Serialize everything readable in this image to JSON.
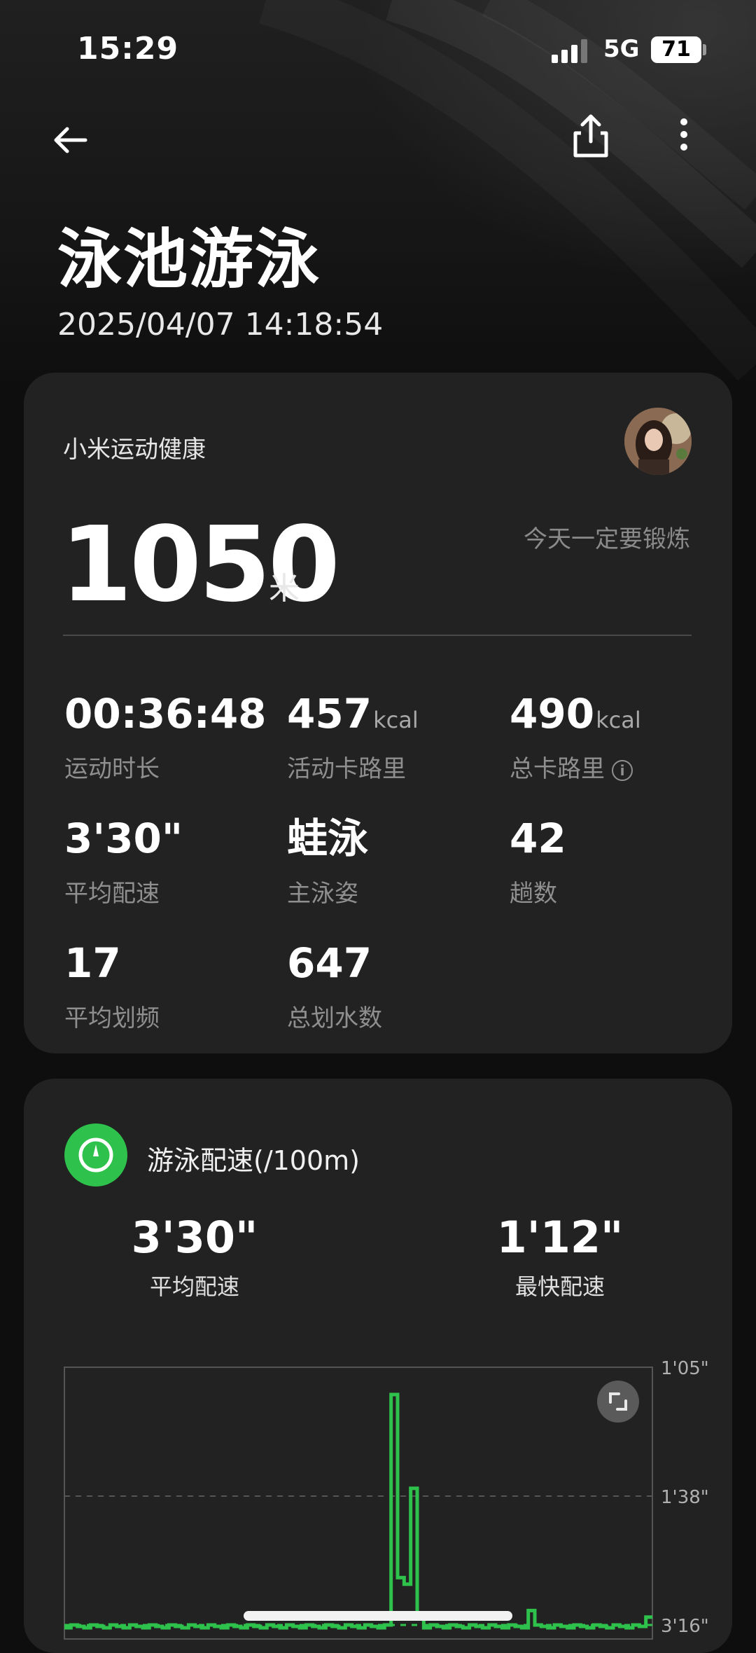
{
  "status_bar": {
    "time": "15:29",
    "network": "5G",
    "battery": "71"
  },
  "nav": {
    "back_icon": "arrow-left-icon",
    "share_icon": "share-icon",
    "more_icon": "more-vertical-icon"
  },
  "header": {
    "title": "泳池游泳",
    "datetime": "2025/04/07 14:18:54"
  },
  "summary": {
    "app_name": "小米运动健康",
    "distance": "1050",
    "distance_unit": "米",
    "motto": "今天一定要锻炼",
    "stats": [
      {
        "value": "00:36:48",
        "unit": "",
        "label": "运动时长"
      },
      {
        "value": "457",
        "unit": "kcal",
        "label": "活动卡路里"
      },
      {
        "value": "490",
        "unit": "kcal",
        "label": "总卡路里"
      },
      {
        "value": "3'30\"",
        "unit": "",
        "label": "平均配速"
      },
      {
        "value": "蛙泳",
        "unit": "",
        "label": "主泳姿"
      },
      {
        "value": "42",
        "unit": "",
        "label": "趟数"
      },
      {
        "value": "17",
        "unit": "",
        "label": "平均划频"
      },
      {
        "value": "647",
        "unit": "",
        "label": "总划水数"
      }
    ]
  },
  "pace": {
    "title": "游泳配速(/100m)",
    "avg_value": "3'30\"",
    "avg_label": "平均配速",
    "fast_value": "1'12\"",
    "fast_label": "最快配速"
  },
  "chart_data": {
    "type": "line",
    "title": "",
    "xlabel": "",
    "ylabel": "",
    "y_ticks": [
      "1'05\"",
      "1'38\"",
      "3'16\""
    ],
    "y_axis_side": "right",
    "y_inverted": true,
    "grid": true,
    "series": [
      {
        "color": "#2ec14c",
        "shape": "step",
        "y_seconds": [
          198,
          196,
          197,
          198,
          196,
          197,
          198,
          196,
          197,
          198,
          196,
          197,
          198,
          196,
          197,
          198,
          196,
          197,
          198,
          196,
          197,
          198,
          196,
          197,
          198,
          196,
          197,
          198,
          196,
          197,
          198,
          196,
          197,
          198,
          196,
          197,
          198,
          196,
          197,
          198,
          196,
          197,
          198,
          196,
          197,
          198,
          196,
          197,
          198,
          196,
          72,
          160,
          165,
          96,
          190,
          198,
          196,
          197,
          198,
          196,
          197,
          198,
          196,
          197,
          198,
          196,
          197,
          198,
          196,
          197,
          198,
          185,
          196,
          197,
          198,
          196,
          197,
          198,
          196,
          197,
          198,
          196,
          197,
          198,
          196,
          197,
          198,
          196,
          197,
          190
        ]
      }
    ]
  },
  "colors": {
    "accent": "#2ec14c",
    "card": "#222222",
    "background": "#0e0e0e"
  }
}
